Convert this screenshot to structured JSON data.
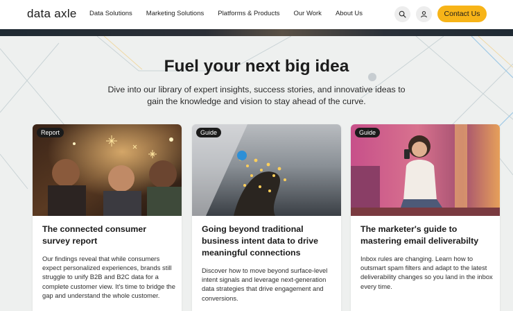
{
  "nav": {
    "logo_word1": "data",
    "logo_word2": "axle",
    "links": [
      "Data Solutions",
      "Marketing Solutions",
      "Platforms & Products",
      "Our Work",
      "About Us"
    ],
    "contact_label": "Contact Us"
  },
  "hero": {
    "title": "Fuel your next big idea",
    "subtitle": "Dive into our library of expert insights, success stories, and innovative ideas to gain the knowledge and vision to stay ahead of the curve."
  },
  "cards": [
    {
      "tag": "Report",
      "title": "The connected consumer survey report",
      "body": "Our findings reveal that while consumers expect personalized experiences, brands still struggle to unify B2B and B2C data for a complete customer view. It's time to bridge the gap and understand the whole customer."
    },
    {
      "tag": "Guide",
      "title": "Going beyond traditional business intent data to drive meaningful connections",
      "body": "Discover how to move beyond surface-level intent signals and leverage next-generation data strategies that drive engagement and conversions."
    },
    {
      "tag": "Guide",
      "title": "The marketer's guide to mastering email deliverabilty",
      "body": "Inbox rules are changing. Learn how to outsmart spam filters and adapt to the latest deliverability changes so you land in the inbox every time."
    }
  ],
  "colors": {
    "accent": "#f7b418",
    "background": "#eef0ef",
    "tag_bg": "#1b1b1b"
  },
  "icons": [
    "search-icon",
    "user-icon"
  ]
}
